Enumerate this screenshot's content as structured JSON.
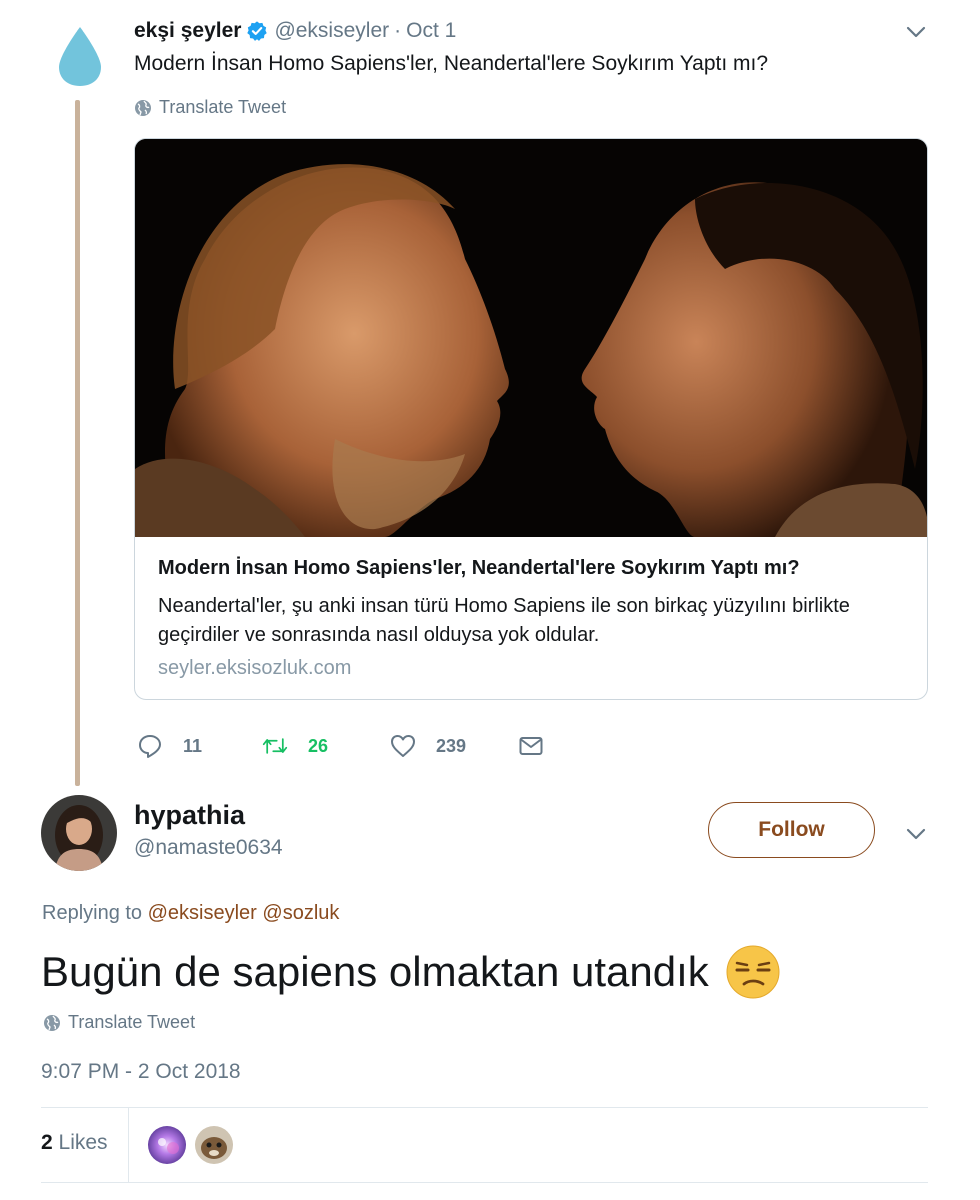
{
  "original_tweet": {
    "avatar_icon": "water-drop-icon",
    "display_name": "ekşi şeyler",
    "verified_icon": "verified-badge-icon",
    "handle": "@eksiseyler",
    "separator": "·",
    "date": "Oct 1",
    "text": "Modern İnsan Homo Sapiens'ler, Neandertal'lere Soykırım Yaptı mı?",
    "translate_label": "Translate Tweet",
    "card": {
      "image_icon": "neanderthal-and-sapiens-photo",
      "title": "Modern İnsan Homo Sapiens'ler, Neandertal'lere Soykırım Yaptı mı?",
      "description": "Neandertal'ler, şu anki insan türü Homo Sapiens ile son birkaç yüzyılını birlikte geçirdiler ve sonrasında nasıl olduysa yok oldular.",
      "domain": "seyler.eksisozluk.com"
    },
    "actions": {
      "reply_count": "11",
      "retweet_count": "26",
      "like_count": "239"
    }
  },
  "reply_tweet": {
    "display_name": "hypathia",
    "handle": "@namaste0634",
    "follow_label": "Follow",
    "replying_to_label": "Replying to",
    "mentions": [
      "@eksiseyler",
      "@sozluk"
    ],
    "text": "Bugün de sapiens olmaktan utandık",
    "emoji_icon": "unamused-face-emoji",
    "translate_label": "Translate Tweet",
    "timestamp": "9:07 PM - 2 Oct 2018",
    "likes_count": "2",
    "likes_label": "Likes"
  },
  "colors": {
    "accent": "#8a4b1f",
    "thread_line": "#c9b29b",
    "retweet_green": "#17bf63",
    "secondary_text": "#657786",
    "verified_blue": "#1da1f2",
    "drop_blue": "#72c4dc"
  }
}
